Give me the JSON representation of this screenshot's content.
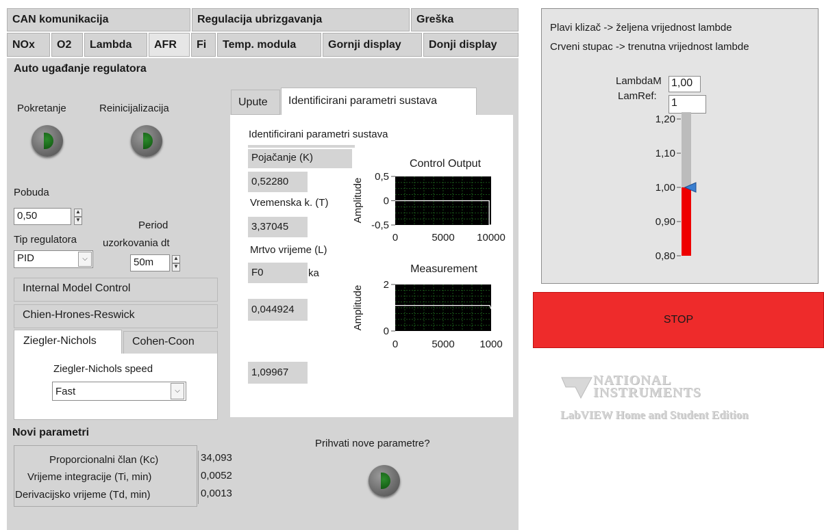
{
  "tabs_row1": [
    "CAN komunikacija",
    "Regulacija ubrizgavanja",
    "Greška"
  ],
  "tabs_row2": [
    "NOx",
    "O2",
    "Lambda",
    "AFR",
    "Fi",
    "Temp. modula",
    "Gornji display",
    "Donji display"
  ],
  "auto": {
    "title": "Auto ugađanje regulatora",
    "start_label": "Pokretanje",
    "reinit_label": "Reinicijalizacija",
    "pobuda_label": "Pobuda",
    "pobuda_value": "0,50",
    "tip_label": "Tip regulatora",
    "tip_value": "PID",
    "period_label_1": "Period",
    "period_label_2": "uzorkovania dt",
    "period_value": "50m",
    "methods": [
      "Internal Model Control",
      "Chien-Hrones-Reswick",
      "Ziegler-Nichols",
      "Cohen-Coon"
    ],
    "zn_speed_label": "Ziegler-Nichols speed",
    "zn_speed_value": "Fast"
  },
  "ident": {
    "tab_upute": "Upute",
    "tab_ident": "Identificirani parametri sustava",
    "heading": "Identificirani parametri sustava",
    "gain_label": "Pojačanje (K)",
    "gain_value": "0,52280",
    "time_label": "Vremenska k. (T)",
    "time_value": "3,37045",
    "dead_label": "Mrtvo vrijeme (L)",
    "dead_prefix": "F0",
    "dead_suffix": "ka",
    "value_4": "0,044924",
    "value_5": "1,09967"
  },
  "chart_data": [
    {
      "type": "line",
      "title": "Control Output",
      "ylabel": "Amplitude",
      "xlim": [
        0,
        10000
      ],
      "ylim": [
        -0.5,
        0.5
      ],
      "xticks": [
        "0",
        "5000",
        "10000"
      ],
      "yticks": [
        "0,5",
        "0",
        "-0,5"
      ],
      "series": [
        {
          "x": [
            0,
            9800,
            9800,
            10000
          ],
          "y": [
            0,
            0,
            -0.5,
            -0.5
          ]
        }
      ]
    },
    {
      "type": "line",
      "title": "Measurement",
      "ylabel": "Amplitude",
      "xlim": [
        0,
        1000
      ],
      "ylim": [
        0,
        2
      ],
      "xticks": [
        "0",
        "5000",
        "1000"
      ],
      "yticks": [
        "2",
        "0"
      ],
      "series": [
        {
          "x": [
            0,
            970,
            985,
            1000
          ],
          "y": [
            1.1,
            1.1,
            1.1,
            0.95
          ]
        }
      ]
    }
  ],
  "novi": {
    "title": "Novi parametri",
    "kc_label": "Proporcionalni član (Kc)",
    "kc_value": "34,093",
    "ti_label": "Vrijeme integracije (Ti, min)",
    "ti_value": "0,0052",
    "td_label": "Derivacijsko vrijeme (Td, min)",
    "td_value": "0,0013",
    "accept_label": "Prihvati nove parametre?"
  },
  "lambda_panel": {
    "line1": "Plavi klizač -> željena vrijednost lambde",
    "line2": "Crveni stupac -> trenutna vrijednost lambde",
    "lambdam_label": "LambdaM",
    "lambdam_value": "1,00",
    "lamref_label": "LamRef:",
    "lamref_value": "1",
    "scale_ticks": [
      "1,20",
      "1,10",
      "1,00",
      "0,90",
      "0,80"
    ],
    "current_value": 1.0,
    "ref_value": 1.0
  },
  "stop_label": "STOP",
  "logo": {
    "line1": "NATIONAL",
    "line2": "INSTRUMENTS",
    "line3": "LabVIEW Home and Student Edition"
  },
  "colors": {
    "panel": "#d4d4d4",
    "stop": "#ee2b2b",
    "bar": "#ee0000",
    "slider": "#3a7fd0",
    "graph_bg": "#000000",
    "graph_grid": "#1f6e1f"
  }
}
